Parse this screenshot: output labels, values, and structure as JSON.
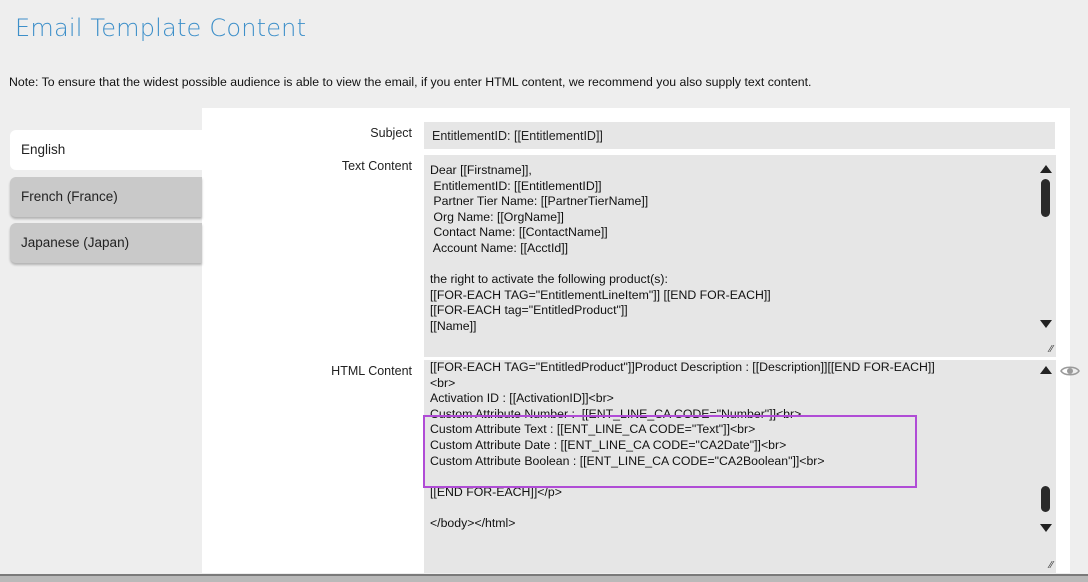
{
  "header": {
    "title": "Email Template Content"
  },
  "note": "Note: To ensure that the widest possible audience is able to view the email, if you enter HTML content, we recommend you also supply text content.",
  "tabs": [
    {
      "label": "English",
      "active": true
    },
    {
      "label": "French (France)",
      "active": false
    },
    {
      "label": "Japanese (Japan)",
      "active": false
    }
  ],
  "form": {
    "subject_label": "Subject",
    "subject_value": "EntitlementID: [[EntitlementID]]",
    "text_label": "Text Content",
    "text_lines": [
      "Dear [[Firstname]],",
      " EntitlementID: [[EntitlementID]]",
      " Partner Tier Name: [[PartnerTierName]]",
      " Org Name: [[OrgName]]",
      " Contact Name: [[ContactName]]",
      " Account Name: [[AcctId]]",
      "",
      "the right to activate the following product(s):",
      "[[FOR-EACH TAG=\"EntitlementLineItem\"]] [[END FOR-EACH]]",
      "[[FOR-EACH tag=\"EntitledProduct\"]]",
      "[[Name]]"
    ],
    "html_label": "HTML Content",
    "html_lines": [
      "[[FOR-EACH TAG=\"EntitledProduct\"]]Product Description : [[Description]][[END FOR-EACH]]",
      "<br>",
      "Activation ID : [[ActivationID]]<br>",
      "Custom Attribute Number :  [[ENT_LINE_CA CODE=\"Number\"]]<br>",
      "Custom Attribute Text : [[ENT_LINE_CA CODE=\"Text\"]]<br>",
      "Custom Attribute Date : [[ENT_LINE_CA CODE=\"CA2Date\"]]<br>",
      "Custom Attribute Boolean : [[ENT_LINE_CA CODE=\"CA2Boolean\"]]<br>",
      "",
      "[[END FOR-EACH]]</p>",
      "",
      "</body></html>"
    ]
  },
  "icons": {
    "preview": "eye-icon",
    "resize": "resize-grip-icon"
  },
  "colors": {
    "title": "#3d8fc9",
    "highlight": "#b04cd6"
  }
}
